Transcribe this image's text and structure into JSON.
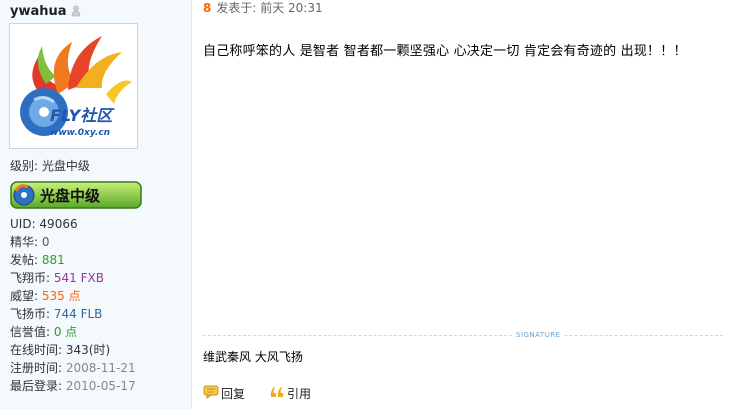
{
  "user": {
    "username": "ywahua",
    "level_label": "级别: 光盘中级",
    "avatar_text": "FLY社区",
    "avatar_url_text": "www.0xy.cn",
    "badge_text": "光盘中级",
    "stats": [
      {
        "label": "UID: ",
        "value": "49066",
        "style": "v-dark"
      },
      {
        "label": "精华: ",
        "value": "0",
        "style": "v-blue"
      },
      {
        "label": "发帖: ",
        "value": "881",
        "style": "v-green"
      },
      {
        "label": "飞翔币: ",
        "value": "541 FXB",
        "style": "v-purple"
      },
      {
        "label": "威望: ",
        "value": "535 点",
        "style": "v-orange"
      },
      {
        "label": "飞扬币: ",
        "value": "744 FLB",
        "style": "v-blue"
      },
      {
        "label": "信誉值: ",
        "value": "0 点",
        "style": "v-green"
      },
      {
        "label": "在线时间: ",
        "value": "343(时)",
        "style": "v-dark"
      },
      {
        "label": "注册时间: ",
        "value": "2008-11-21",
        "style": "v-gray"
      },
      {
        "label": "最后登录: ",
        "value": "2010-05-17",
        "style": "v-gray"
      }
    ]
  },
  "post": {
    "floor": "8",
    "meta": "发表于: 前天  20:31",
    "body": "自己称呼笨的人 是智者  智者都一颗坚强心  心决定一切  肯定会有奇迹的  出现！！！",
    "signature_label": "SIGNATURE",
    "signature": "维武秦风 大风飞扬"
  },
  "actions": {
    "reply_label": "回复",
    "quote_label": "引用"
  },
  "colors": {
    "floor": "#ff6600",
    "sidebar_bg": "#f4f9fd"
  }
}
